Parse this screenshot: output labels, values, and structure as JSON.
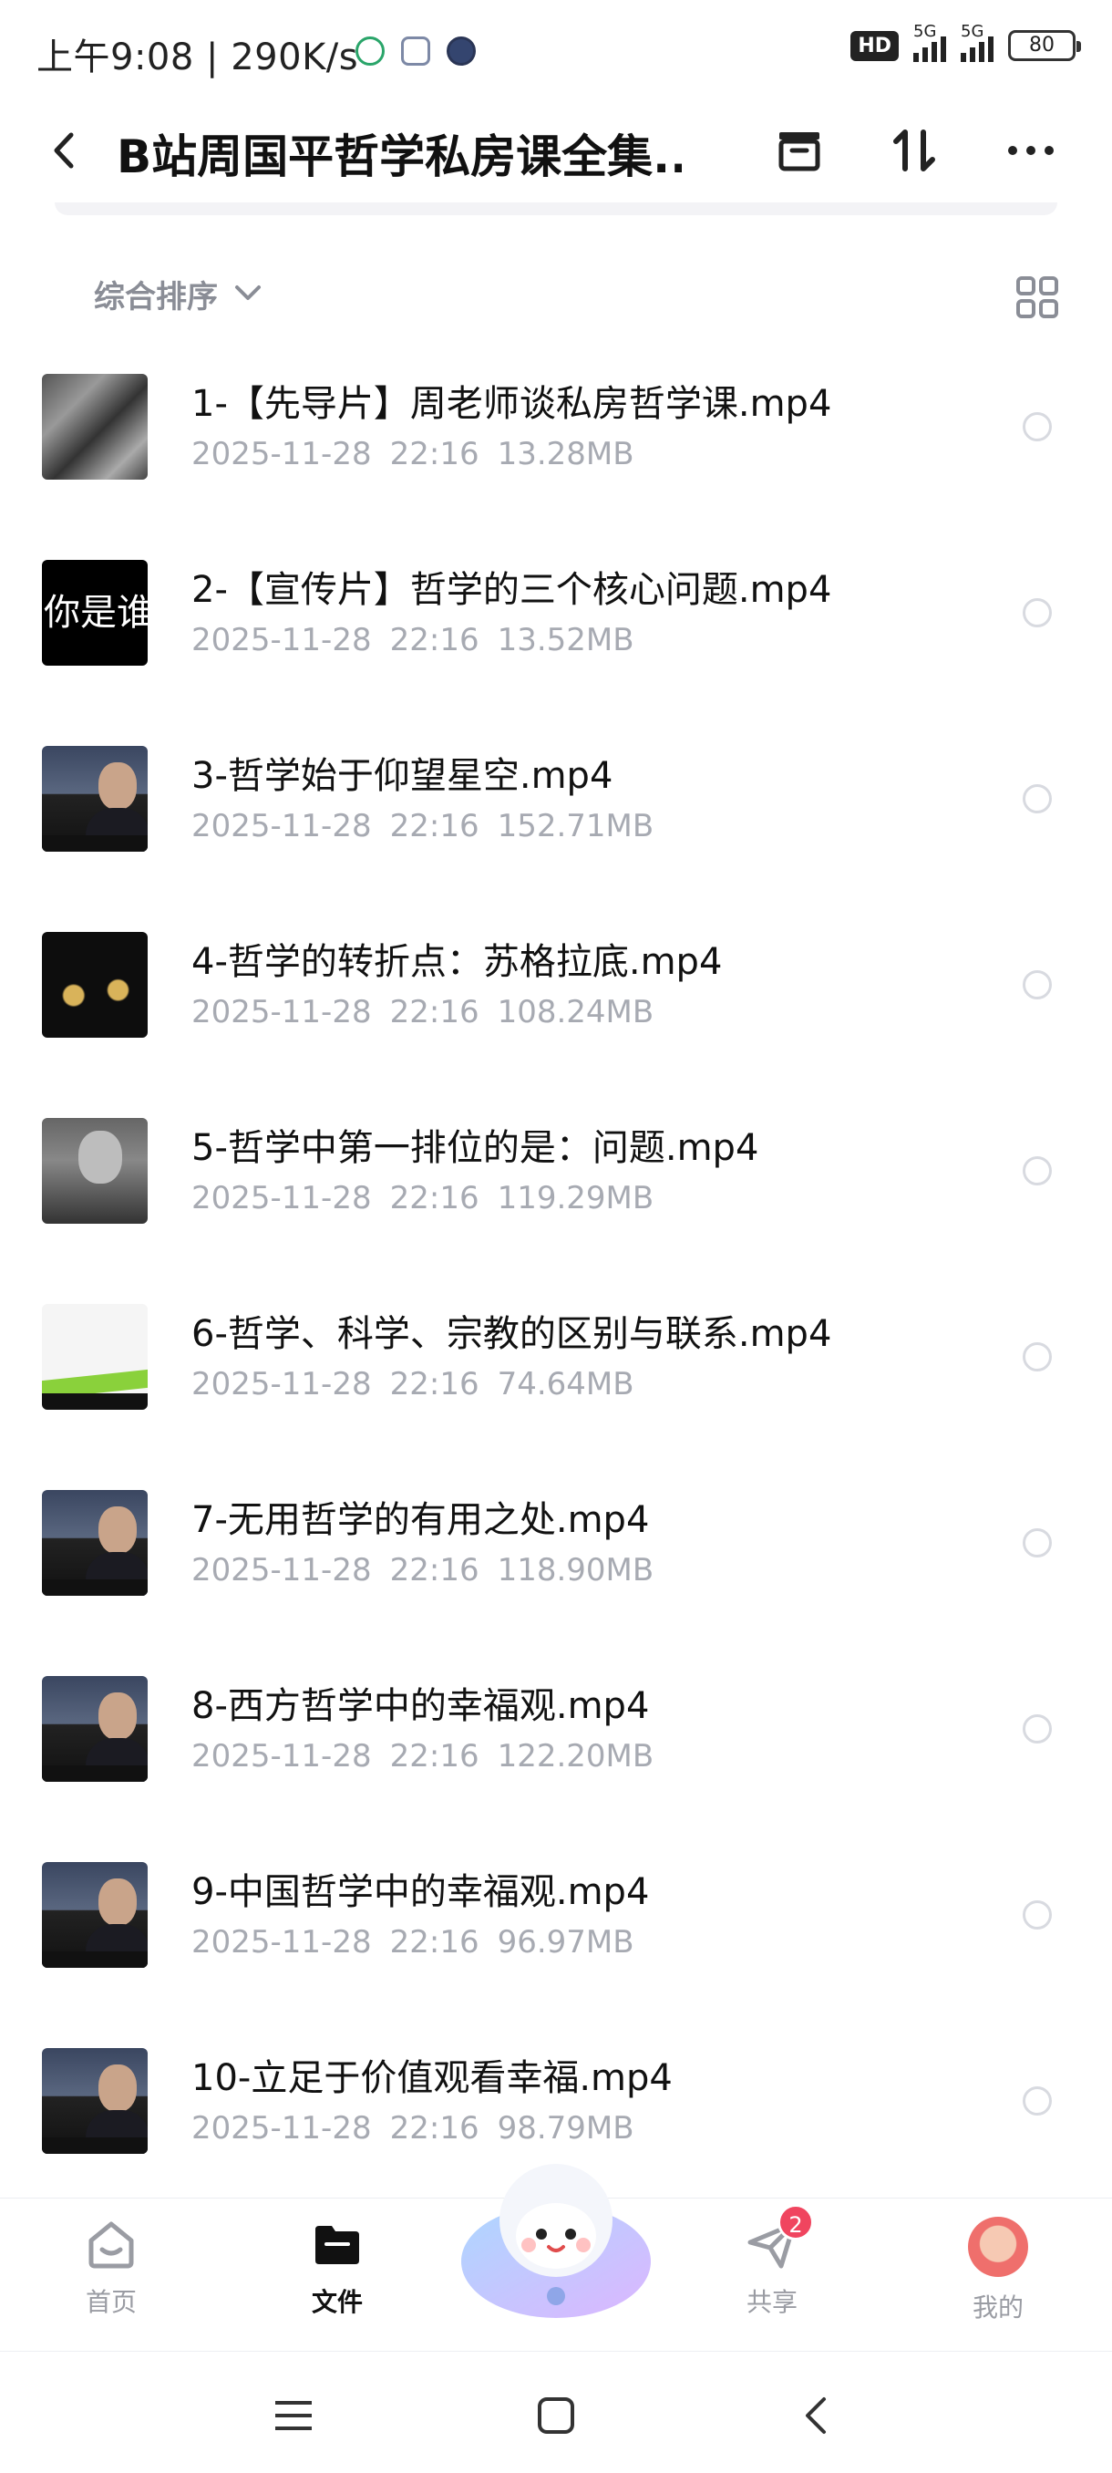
{
  "status_bar": {
    "time": "上午9:08 | 290K/s",
    "hd_badge": "HD",
    "signal1": "5G",
    "signal2": "5G",
    "battery": "80"
  },
  "header": {
    "title": "B站周国平哲学私房课全集...",
    "icons": [
      "back-icon",
      "archive-icon",
      "sort-icon",
      "more-icon"
    ]
  },
  "sort": {
    "label": "综合排序"
  },
  "files": [
    {
      "name": "1-【先导片】周老师谈私房哲学课.mp4",
      "date": "2025-11-28",
      "time": "22:16",
      "size": "13.28MB",
      "thumb": "bw"
    },
    {
      "name": "2-【宣传片】哲学的三个核心问题.mp4",
      "date": "2025-11-28",
      "time": "22:16",
      "size": "13.52MB",
      "thumb": "text",
      "thumb_text": "你是谁"
    },
    {
      "name": "3-哲学始于仰望星空.mp4",
      "date": "2025-11-28",
      "time": "22:16",
      "size": "152.71MB",
      "thumb": "person"
    },
    {
      "name": "4-哲学的转折点：苏格拉底.mp4",
      "date": "2025-11-28",
      "time": "22:16",
      "size": "108.24MB",
      "thumb": "stage"
    },
    {
      "name": "5-哲学中第一排位的是：问题.mp4",
      "date": "2025-11-28",
      "time": "22:16",
      "size": "119.29MB",
      "thumb": "gray"
    },
    {
      "name": "6-哲学、科学、宗教的区别与联系.mp4",
      "date": "2025-11-28",
      "time": "22:16",
      "size": "74.64MB",
      "thumb": "slide"
    },
    {
      "name": "7-无用哲学的有用之处.mp4",
      "date": "2025-11-28",
      "time": "22:16",
      "size": "118.90MB",
      "thumb": "person"
    },
    {
      "name": "8-西方哲学中的幸福观.mp4",
      "date": "2025-11-28",
      "time": "22:16",
      "size": "122.20MB",
      "thumb": "person"
    },
    {
      "name": "9-中国哲学中的幸福观.mp4",
      "date": "2025-11-28",
      "time": "22:16",
      "size": "96.97MB",
      "thumb": "person"
    },
    {
      "name": "10-立足于价值观看幸福.mp4",
      "date": "2025-11-28",
      "time": "22:16",
      "size": "98.79MB",
      "thumb": "person"
    }
  ],
  "bottom_nav": {
    "home": "首页",
    "files": "文件",
    "share": "共享",
    "share_badge": "2",
    "me": "我的"
  },
  "colors": {
    "accent_badge": "#f0455f",
    "meta_gray": "#a7aab2"
  }
}
